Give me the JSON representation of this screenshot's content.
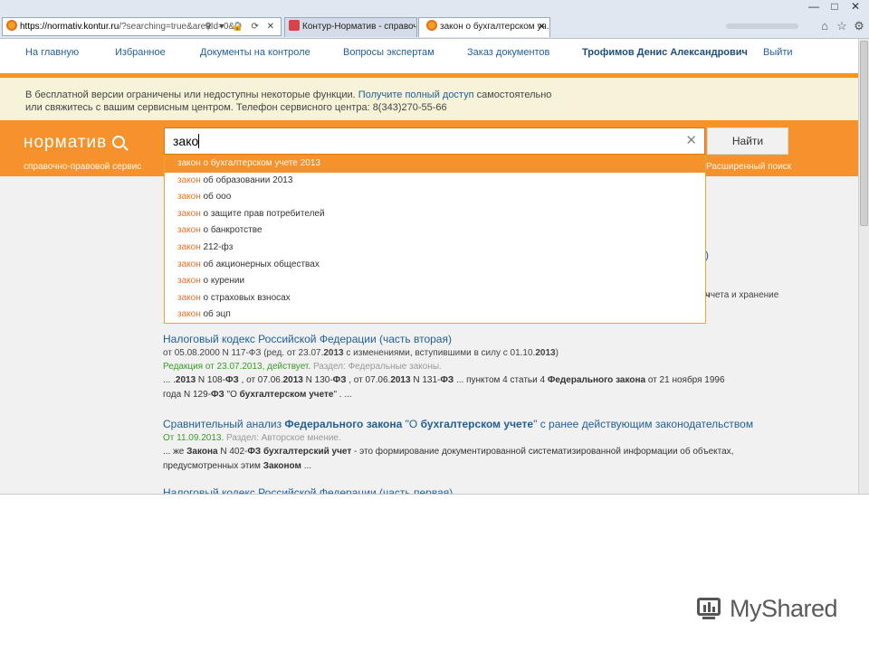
{
  "browser": {
    "address_host": "https://normativ.kontur.ru",
    "address_rest": "/?searching=true&areaId=0&Q",
    "address_controls": "⚲ ▾ 🔒 ⟳ ✕",
    "tabs": [
      {
        "label": "Контур-Норматив - справоч..."
      },
      {
        "label": "закон о бухгалтерском уч..."
      }
    ],
    "window_controls": [
      "—",
      "□",
      "✕"
    ],
    "chrome_icons": [
      "⌂",
      "☆",
      "⚙"
    ]
  },
  "nav": {
    "items": [
      "На главную",
      "Избранное",
      "Документы на контроле",
      "Вопросы экспертам",
      "Заказ документов"
    ],
    "user": "Трофимов Денис Александрович",
    "logout": "Выйти"
  },
  "notice": {
    "text1": "В бесплатной версии ограничены или недоступны некоторые функции. ",
    "link": "Получите полный доступ",
    "text2": " самостоятельно",
    "line2": "или свяжитесь с вашим сервисным центром. Телефон сервисного центра: 8(343)270-55-66"
  },
  "search": {
    "logo": "норматив",
    "tagline": "справочно-правовой сервис",
    "query": "зако",
    "clear": "✕",
    "button": "Найти",
    "advanced": "Расширенный поиск",
    "suggestions": [
      {
        "hl": "закон",
        "rest": " о бухгалтерском учете 2013"
      },
      {
        "hl": "закон",
        "rest": " об образовании 2013"
      },
      {
        "hl": "закон",
        "rest": " об ооо"
      },
      {
        "hl": "закон",
        "rest": " о защите прав потребителей"
      },
      {
        "hl": "закон",
        "rest": " о банкротстве"
      },
      {
        "hl": "закон",
        "rest": " 212-фз"
      },
      {
        "hl": "закон",
        "rest": " об акционерных обществах"
      },
      {
        "hl": "закон",
        "rest": " о курении"
      },
      {
        "hl": "закон",
        "rest": " о страховых взносах"
      },
      {
        "hl": "закон",
        "rest": " об эцп"
      }
    ]
  },
  "behind": {
    "paren": ")",
    "snippet": "чета и хранение"
  },
  "results": [
    {
      "title": "Налоговый кодекс Российской Федерации (часть вторая)",
      "line_parts": [
        {
          "t": "от 05.08.2000 N 117-ФЗ (ред. от 23.07.",
          "b": false
        },
        {
          "t": "2013",
          "b": true
        },
        {
          "t": " с изменениями, вступившими в силу с 01.10.",
          "b": false
        },
        {
          "t": "2013",
          "b": true
        },
        {
          "t": ")",
          "b": false
        }
      ],
      "status_green": "Редакция от 23.07.2013, действует.",
      "status_grey": " Раздел: Федеральные законы.",
      "snippet_parts": [
        {
          "t": "... .",
          "b": false
        },
        {
          "t": "2013",
          "b": true
        },
        {
          "t": " N 108-",
          "b": false
        },
        {
          "t": "ФЗ",
          "b": true
        },
        {
          "t": " , от 07.06.",
          "b": false
        },
        {
          "t": "2013",
          "b": true
        },
        {
          "t": " N 130-",
          "b": false
        },
        {
          "t": "ФЗ",
          "b": true
        },
        {
          "t": " , от 07.06.",
          "b": false
        },
        {
          "t": "2013",
          "b": true
        },
        {
          "t": " N 131-",
          "b": false
        },
        {
          "t": "ФЗ",
          "b": true
        },
        {
          "t": " ... пунктом 4 статьи 4 ",
          "b": false
        },
        {
          "t": "Федерального закона",
          "b": true
        },
        {
          "t": " от 21 ноября 1996 года N 129-",
          "b": false
        },
        {
          "t": "ФЗ",
          "b": true
        },
        {
          "t": " \"О ",
          "b": false
        },
        {
          "t": "бухгалтерском учете",
          "b": true
        },
        {
          "t": "\" . ...",
          "b": false
        }
      ]
    },
    {
      "title_parts": [
        {
          "t": "Сравнительный анализ ",
          "b": false
        },
        {
          "t": "Федерального закона",
          "b": true
        },
        {
          "t": " \"О ",
          "b": false
        },
        {
          "t": "бухгалтерском учете",
          "b": true
        },
        {
          "t": "\" с ранее действующим законодательством",
          "b": false
        }
      ],
      "status_green": "От 11.09.2013.",
      "status_grey": " Раздел: Авторское мнение.",
      "snippet_parts": [
        {
          "t": "... же ",
          "b": false
        },
        {
          "t": "Закона",
          "b": true
        },
        {
          "t": " N 402-",
          "b": false
        },
        {
          "t": "ФЗ бухгалтерский учет",
          "b": true
        },
        {
          "t": " - это формирование документированной систематизированной информации об объектах, предусмотренных этим ",
          "b": false
        },
        {
          "t": "Законом",
          "b": true
        },
        {
          "t": " ...",
          "b": false
        }
      ]
    }
  ],
  "cutoff_title": "Налоговый кодекс Российской Федерации (часть первая)",
  "watermark": {
    "text": "MyShared",
    "icon": "presentation-chart-icon"
  }
}
